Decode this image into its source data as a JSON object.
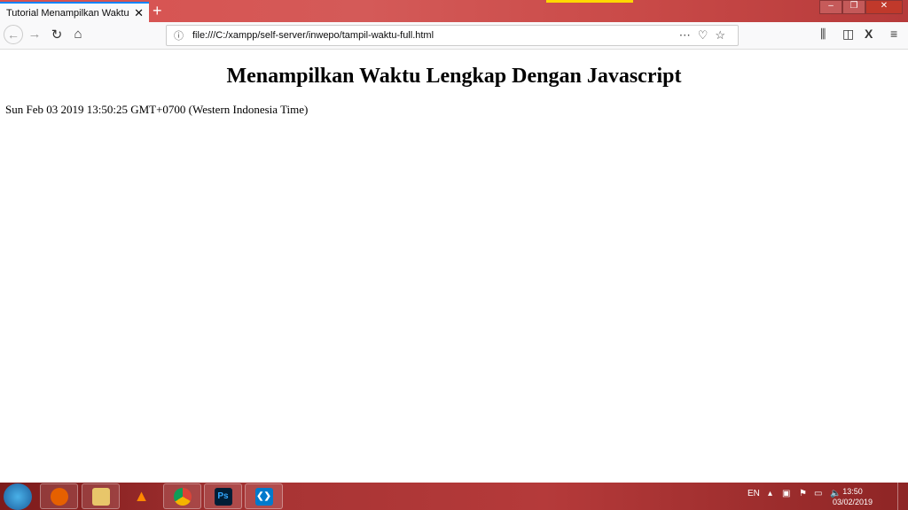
{
  "browser": {
    "tab_title": "Tutorial Menampilkan Waktu Lengkap Dengan Javascript",
    "url": "file:///C:/xampp/self-server/inwepo/tampil-waktu-full.html"
  },
  "page": {
    "heading": "Menampilkan Waktu Lengkap Dengan Javascript",
    "time_text": "Sun Feb 03 2019 13:50:25 GMT+0700 (Western Indonesia Time)"
  },
  "taskbar": {
    "language": "EN",
    "clock_time": "13:50",
    "clock_date": "03/02/2019",
    "apps": [
      "firefox",
      "file-explorer",
      "vlc",
      "chrome",
      "photoshop",
      "visual-studio-code"
    ]
  },
  "colors": {
    "accent": "#0a84ff",
    "titlebar": "#d45a58"
  }
}
